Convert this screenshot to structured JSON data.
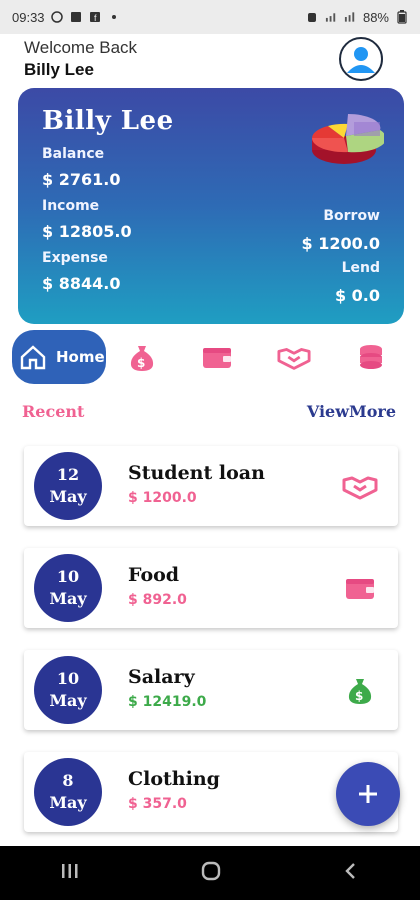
{
  "status_bar": {
    "time": "09:33",
    "battery": "88%"
  },
  "header": {
    "welcome": "Welcome Back",
    "username": "Billy Lee"
  },
  "card": {
    "name": "Billy Lee",
    "balance_label": "Balance",
    "balance": "$ 2761.0",
    "income_label": "Income",
    "income": "$ 12805.0",
    "expense_label": "Expense",
    "expense": "$ 8844.0",
    "borrow_label": "Borrow",
    "borrow": "$ 1200.0",
    "lend_label": "Lend",
    "lend": "$ 0.0"
  },
  "nav": {
    "home_label": "Home",
    "items": [
      "money-bag-icon",
      "wallet-icon",
      "handshake-icon",
      "coins-icon"
    ]
  },
  "recent": {
    "label": "Recent",
    "view_more": "ViewMore"
  },
  "transactions": [
    {
      "day": "12",
      "month": "May",
      "title": "Student loan",
      "amount": "$ 1200.0",
      "icon": "handshake-icon"
    },
    {
      "day": "10",
      "month": "May",
      "title": "Food",
      "amount": "$ 892.0",
      "icon": "wallet-icon"
    },
    {
      "day": "10",
      "month": "May",
      "title": "Salary",
      "amount": "$ 12419.0",
      "icon": "money-bag-icon"
    },
    {
      "day": "8",
      "month": "May",
      "title": "Clothing",
      "amount": "$ 357.0",
      "icon": ""
    }
  ],
  "colors": {
    "accent_pink": "#f06292",
    "accent_green": "#3daa4a",
    "navy": "#2a3593"
  }
}
